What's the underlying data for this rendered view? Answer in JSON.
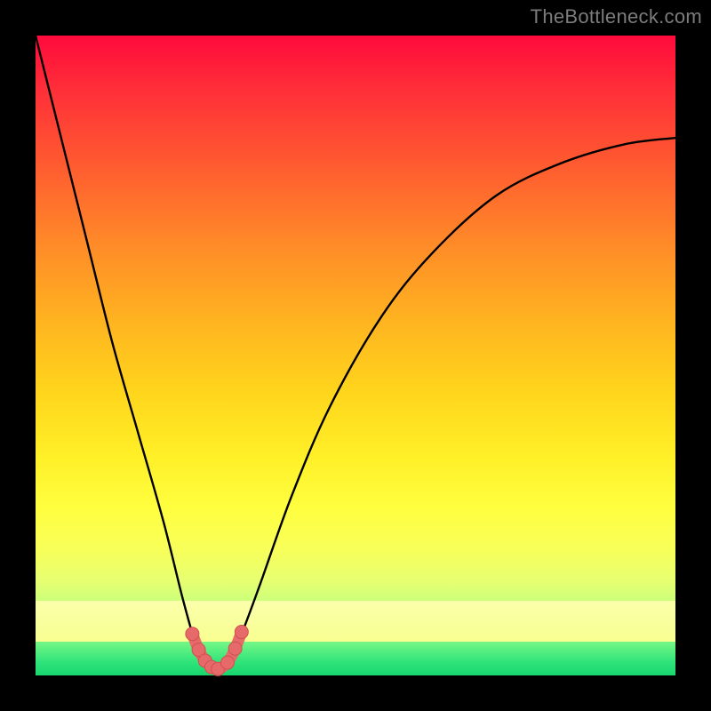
{
  "watermark": "TheBottleneck.com",
  "colors": {
    "page_bg": "#000000",
    "curve_stroke": "#000000",
    "marker_fill": "#e66a6a",
    "marker_stroke": "#d24f4f",
    "gradient_top": "#ff0a3c",
    "gradient_bottom": "#19d66e"
  },
  "chart_data": {
    "type": "line",
    "title": "",
    "xlabel": "",
    "ylabel": "",
    "x_range": [
      0,
      100
    ],
    "y_range": [
      0,
      100
    ],
    "series": [
      {
        "name": "bottleneck-curve",
        "x": [
          0,
          4,
          8,
          12,
          16,
          20,
          23,
          25,
          26.5,
          28,
          30,
          32,
          35,
          40,
          46,
          54,
          62,
          72,
          82,
          92,
          100
        ],
        "y": [
          100,
          84,
          68,
          52,
          38,
          24,
          12,
          5,
          2,
          0.7,
          2,
          6,
          14,
          28,
          42,
          56,
          66,
          75,
          80,
          83,
          84
        ]
      }
    ],
    "markers": {
      "name": "highlight-points",
      "x": [
        24.5,
        25.5,
        26.5,
        27.5,
        28.5,
        30.0,
        31.2,
        32.2
      ],
      "y": [
        6.5,
        4.0,
        2.3,
        1.3,
        1.0,
        2.0,
        4.2,
        6.8
      ]
    },
    "annotations": []
  }
}
